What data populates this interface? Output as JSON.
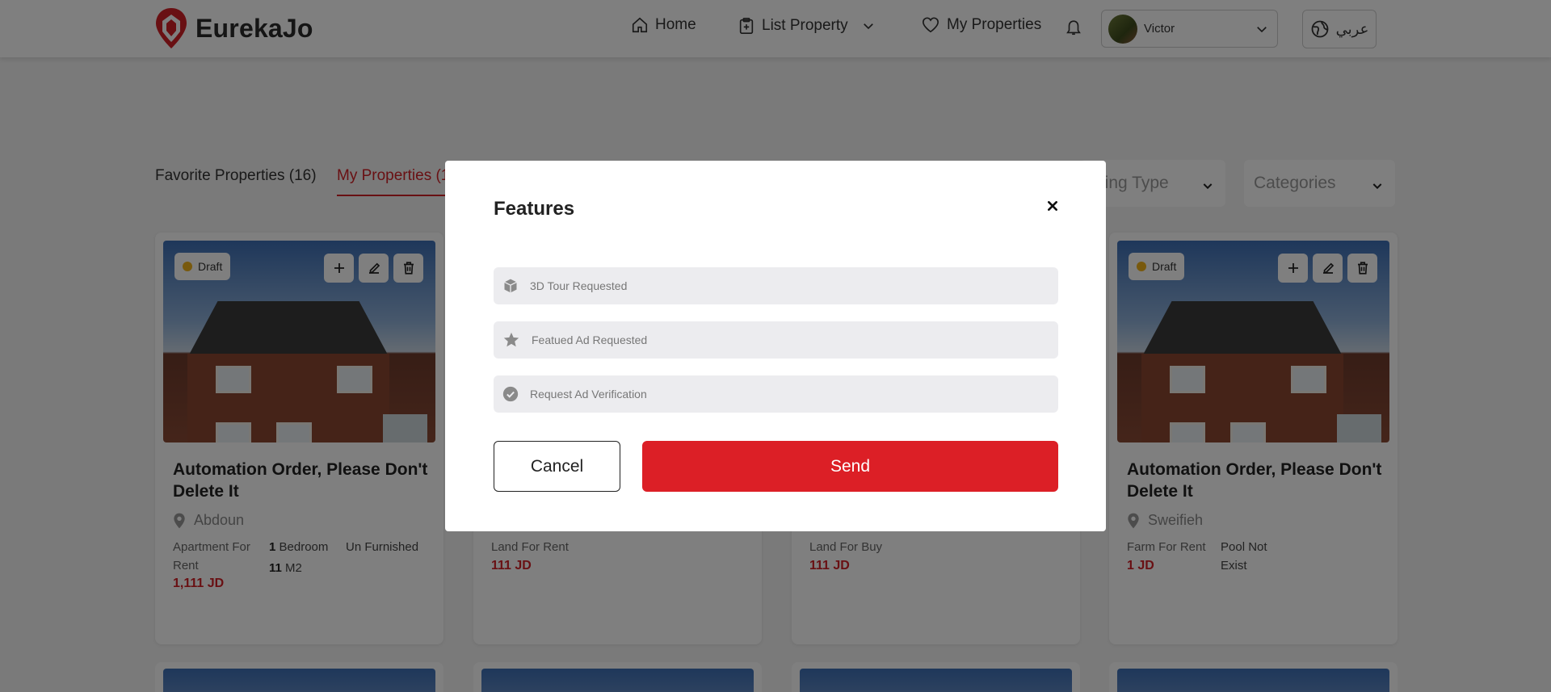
{
  "header": {
    "brand": "EurekaJo",
    "nav": {
      "home": "Home",
      "list_property": "List Property",
      "my_properties": "My Properties"
    },
    "user": {
      "name": "Victor"
    },
    "language": "عربي"
  },
  "tabs": {
    "favorites": "Favorite Properties (16)",
    "mine": "My Properties (1"
  },
  "filters": {
    "offering_type": "ering Type",
    "categories": "Categories"
  },
  "cards": [
    {
      "status": "Draft",
      "title": "Automation Order, Please Don't Delete It",
      "location": "Abdoun",
      "type": "Apartment For Rent",
      "price": "1,111 JD",
      "bedrooms_count": "1",
      "bedrooms_label": "Bedroom",
      "area_value": "11",
      "area_unit": "M2",
      "furnishing": "Un Furnished"
    },
    {
      "type": "Land For Rent",
      "price": "111 JD"
    },
    {
      "type": "Land For Buy",
      "price": "111 JD"
    },
    {
      "status": "Draft",
      "title": "Automation Order, Please Don't Delete It",
      "location": "Sweifieh",
      "type": "Farm For Rent",
      "price": "1 JD",
      "pool": "Pool Not Exist"
    }
  ],
  "modal": {
    "title": "Features",
    "options": [
      {
        "label": "3D Tour Requested",
        "icon": "cube-icon"
      },
      {
        "label": "Featued Ad Requested",
        "icon": "star-icon"
      },
      {
        "label": "Request Ad Verification",
        "icon": "check-circle-icon"
      }
    ],
    "cancel_label": "Cancel",
    "send_label": "Send"
  },
  "colors": {
    "accent": "#dc1f26",
    "draft_dot": "#f0b21a"
  }
}
